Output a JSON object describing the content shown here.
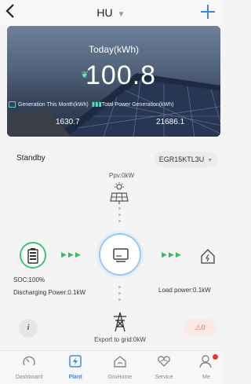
{
  "header": {
    "back_icon": "chevron-left-icon",
    "title": "HU",
    "add_icon": "plus-icon"
  },
  "hero": {
    "label": "Today(kWh)",
    "value": "100.8",
    "month_label": "Generation This Month(kWh)",
    "month_value": "1630.7",
    "total_label": "Total Power Generation(kWh)",
    "total_value": "21686.1"
  },
  "status": {
    "state": "Standby",
    "device": "EGR15KTL3U",
    "ppv": "Ppv:0kW",
    "soc": "SOC:100%",
    "discharging": "Discharging Power:0.1kW",
    "load": "Load power:0.1kW",
    "export": "Export to grid:0kW",
    "info_icon": "info-icon",
    "alarm_count": "0",
    "alarm_icon": "alarm-icon"
  },
  "colors": {
    "accent": "#3a8be8",
    "battery_green": "#38c77a",
    "alarm_orange": "#f26b3a"
  },
  "nav": {
    "items": [
      {
        "label": "Dashboard",
        "icon": "dashboard-icon"
      },
      {
        "label": "Plant",
        "icon": "plant-icon"
      },
      {
        "label": "GroHome",
        "icon": "home-icon"
      },
      {
        "label": "Service",
        "icon": "service-icon"
      },
      {
        "label": "Me",
        "icon": "user-icon"
      }
    ]
  }
}
